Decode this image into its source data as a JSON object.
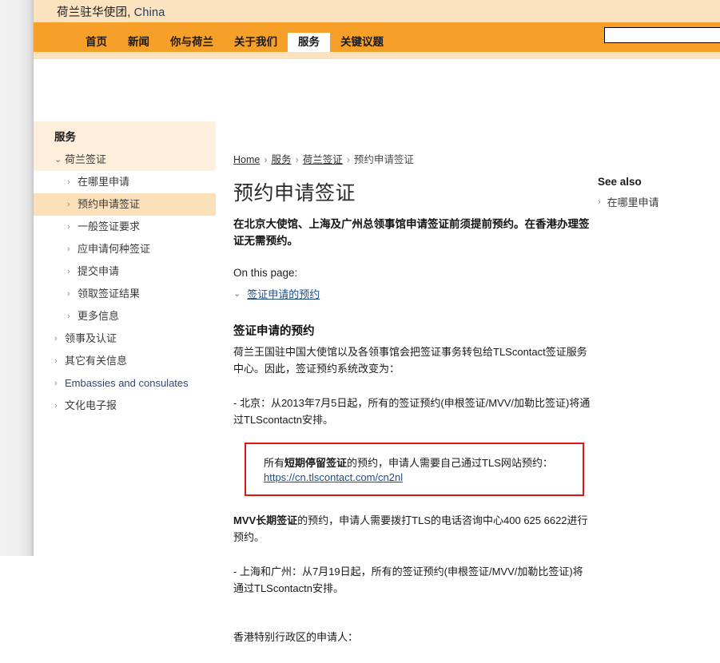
{
  "browser": {
    "gutter_color": "#efeff0"
  },
  "header": {
    "site_title_cn": "荷兰驻华使团",
    "site_title_sep": ",",
    "site_title_country": "China",
    "bar_color": "#fbe3bf",
    "nav_color": "#f6a02a"
  },
  "nav": {
    "tabs": [
      {
        "label": "首页",
        "active": false
      },
      {
        "label": "新闻",
        "active": false
      },
      {
        "label": "你与荷兰",
        "active": false
      },
      {
        "label": "关于我们",
        "active": false
      },
      {
        "label": "服务",
        "active": true
      },
      {
        "label": "关键议题",
        "active": false
      }
    ],
    "search": {
      "value": "",
      "placeholder": ""
    }
  },
  "sidebar": {
    "heading": "服务",
    "items": [
      {
        "label": "荷兰签证",
        "level": 1,
        "icon": "chevron-down-icon",
        "selected": false,
        "english": false
      },
      {
        "label": "在哪里申请",
        "level": 2,
        "icon": "chevron-right-icon",
        "selected": false,
        "english": false
      },
      {
        "label": "预约申请签证",
        "level": 2,
        "icon": "chevron-right-icon",
        "selected": true,
        "english": false
      },
      {
        "label": "一般签证要求",
        "level": 2,
        "icon": "chevron-right-icon",
        "selected": false,
        "english": false
      },
      {
        "label": "应申请何种签证",
        "level": 2,
        "icon": "chevron-right-icon",
        "selected": false,
        "english": false
      },
      {
        "label": "提交申请",
        "level": 2,
        "icon": "chevron-right-icon",
        "selected": false,
        "english": false
      },
      {
        "label": "领取签证结果",
        "level": 2,
        "icon": "chevron-right-icon",
        "selected": false,
        "english": false
      },
      {
        "label": "更多信息",
        "level": 2,
        "icon": "chevron-right-icon",
        "selected": false,
        "english": false
      },
      {
        "label": "领事及认证",
        "level": 1,
        "icon": "chevron-right-icon",
        "selected": false,
        "english": false
      },
      {
        "label": "其它有关信息",
        "level": 1,
        "icon": "chevron-right-icon",
        "selected": false,
        "english": false
      },
      {
        "label": "Embassies and consulates",
        "level": 1,
        "icon": "chevron-right-icon",
        "selected": false,
        "english": true
      },
      {
        "label": "文化电子报",
        "level": 1,
        "icon": "chevron-right-icon",
        "selected": false,
        "english": false
      }
    ]
  },
  "breadcrumb": {
    "items": [
      {
        "label": "Home",
        "link": true
      },
      {
        "label": "服务",
        "link": true
      },
      {
        "label": "荷兰签证",
        "link": true
      },
      {
        "label": "预约申请签证",
        "link": false
      }
    ],
    "separator": "›"
  },
  "main": {
    "page_title": "预约申请签证",
    "lead": "在北京大使馆、上海及广州总领事馆申请签证前须提前预约。在香港办理签证无需预约。",
    "on_this_page_label": "On this page:",
    "toc": [
      {
        "label": "签证申请的预约",
        "icon": "chevron-down-icon"
      }
    ],
    "section_heading": "签证申请的预约",
    "para_intro": "荷兰王国驻中国大使馆以及各领事馆会把签证事务转包给TLScontact签证服务中心。因此，签证预约系统改变为：",
    "para_beijing": "- 北京：从2013年7月5日起，所有的签证预约(申根签证/MVV/加勒比签证)将通过TLScontactn安排。",
    "red_box": {
      "text_prefix": "所有",
      "text_bold": "短期停留签证",
      "text_suffix": "的预约，申请人需要自己通过TLS网站预约：",
      "link_text": "https://cn.tlscontact.com/cn2nl",
      "border_color": "#e01616"
    },
    "para_mvv_bold": "MVV长期签证",
    "para_mvv_rest": "的预约，申请人需要拨打TLS的电话咨询中心400 625 6622进行预约。",
    "para_shanghai": "- 上海和广州：从7月19日起，所有的签证预约(申根签证/MVV/加勒比签证)将通过TLScontactn安排。",
    "para_hongkong": "香港特别行政区的申请人："
  },
  "see_also": {
    "title": "See also",
    "items": [
      {
        "label": "在哪里申请",
        "icon": "chevron-right-icon"
      }
    ]
  }
}
